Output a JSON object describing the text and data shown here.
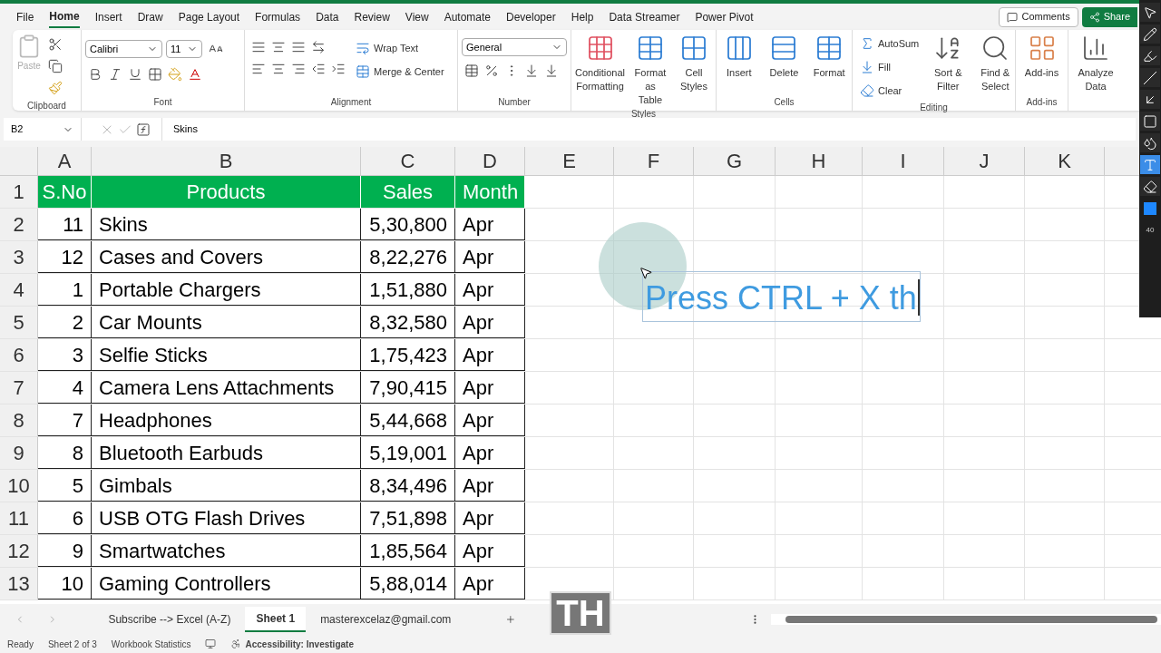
{
  "menu_tabs": [
    {
      "label": "File",
      "selected": false
    },
    {
      "label": "Home",
      "selected": true
    },
    {
      "label": "Insert",
      "selected": false
    },
    {
      "label": "Draw",
      "selected": false
    },
    {
      "label": "Page Layout",
      "selected": false
    },
    {
      "label": "Formulas",
      "selected": false
    },
    {
      "label": "Data",
      "selected": false
    },
    {
      "label": "Review",
      "selected": false
    },
    {
      "label": "View",
      "selected": false
    },
    {
      "label": "Automate",
      "selected": false
    },
    {
      "label": "Developer",
      "selected": false
    },
    {
      "label": "Help",
      "selected": false
    },
    {
      "label": "Data Streamer",
      "selected": false
    },
    {
      "label": "Power Pivot",
      "selected": false
    }
  ],
  "title_buttons": [
    "Comments",
    "Share"
  ],
  "ribbon": {
    "clipboard": {
      "paste": "Paste",
      "group": "Clipboard"
    },
    "font": {
      "name": "Calibri",
      "size": "11",
      "group": "Font"
    },
    "alignment": {
      "wrap": "Wrap Text",
      "merge": "Merge & Center",
      "group": "Alignment"
    },
    "number": {
      "format": "General",
      "group": "Number"
    },
    "styles": {
      "items": [
        "Conditional Formatting",
        "Format as Table",
        "Cell Styles"
      ],
      "group": "Styles"
    },
    "cells": {
      "items": [
        "Insert",
        "Delete",
        "Format"
      ],
      "group": "Cells"
    },
    "editing": {
      "autosum": "AutoSum",
      "fill": "Fill",
      "clear": "Clear",
      "sort": "Sort & Filter",
      "find": "Find & Select",
      "group": "Editing"
    },
    "addins": {
      "label": "Add-ins",
      "group": "Add-ins"
    },
    "analyze": {
      "label": "Analyze Data"
    }
  },
  "formula_bar": {
    "name_box": "B2",
    "value": "Skins"
  },
  "columns": [
    "A",
    "B",
    "C",
    "D",
    "E",
    "F",
    "G",
    "H",
    "I",
    "J",
    "K"
  ],
  "rows": [
    {
      "number": "1",
      "kind": "header",
      "cells": [
        "S.No",
        "Products",
        "Sales",
        "Month"
      ]
    },
    {
      "number": "2",
      "kind": "data",
      "cells": [
        "11",
        "Skins",
        "5,30,800",
        "Apr"
      ]
    },
    {
      "number": "3",
      "kind": "data",
      "cells": [
        "12",
        "Cases and Covers",
        "8,22,276",
        "Apr"
      ]
    },
    {
      "number": "4",
      "kind": "data",
      "cells": [
        "1",
        "Portable Chargers",
        "1,51,880",
        "Apr"
      ]
    },
    {
      "number": "5",
      "kind": "data",
      "cells": [
        "2",
        "Car Mounts",
        "8,32,580",
        "Apr"
      ]
    },
    {
      "number": "6",
      "kind": "data",
      "cells": [
        "3",
        "Selfie Sticks",
        "1,75,423",
        "Apr"
      ]
    },
    {
      "number": "7",
      "kind": "data",
      "cells": [
        "4",
        "Camera Lens Attachments",
        "7,90,415",
        "Apr"
      ]
    },
    {
      "number": "8",
      "kind": "data",
      "cells": [
        "7",
        "Headphones",
        "5,44,668",
        "Apr"
      ]
    },
    {
      "number": "9",
      "kind": "data",
      "cells": [
        "8",
        "Bluetooth Earbuds",
        "5,19,001",
        "Apr"
      ]
    },
    {
      "number": "10",
      "kind": "data",
      "cells": [
        "5",
        "Gimbals",
        "8,34,496",
        "Apr"
      ]
    },
    {
      "number": "11",
      "kind": "data",
      "cells": [
        "6",
        "USB OTG Flash Drives",
        "7,51,898",
        "Apr"
      ]
    },
    {
      "number": "12",
      "kind": "data",
      "cells": [
        "9",
        "Smartwatches",
        "1,85,564",
        "Apr"
      ]
    },
    {
      "number": "13",
      "kind": "data",
      "cells": [
        "10",
        "Gaming Controllers",
        "5,88,014",
        "Apr"
      ]
    }
  ],
  "text_box": {
    "text": "Press CTRL + X th"
  },
  "key_overlay": "TH",
  "sheet_tabs": [
    {
      "label": "Subscribe --> Excel (A-Z)",
      "selected": false
    },
    {
      "label": "Sheet 1",
      "selected": true
    },
    {
      "label": "masterexcelaz@gmail.com",
      "selected": false
    }
  ],
  "status_bar": {
    "mode": "Ready",
    "sheet": "Sheet 2 of 3",
    "stats": "Workbook Statistics",
    "accessibility": "Accessibility: Investigate"
  },
  "annotation_tools": [
    {
      "kind": "pointer",
      "selected": false
    },
    {
      "kind": "pen",
      "selected": false
    },
    {
      "kind": "highlighter",
      "selected": false
    },
    {
      "kind": "line",
      "selected": false
    },
    {
      "kind": "arrow",
      "selected": false
    },
    {
      "kind": "rectangle",
      "selected": false
    },
    {
      "kind": "blur",
      "selected": false
    },
    {
      "kind": "text",
      "selected": true
    },
    {
      "kind": "eraser",
      "selected": false
    }
  ],
  "pen_size": "40"
}
